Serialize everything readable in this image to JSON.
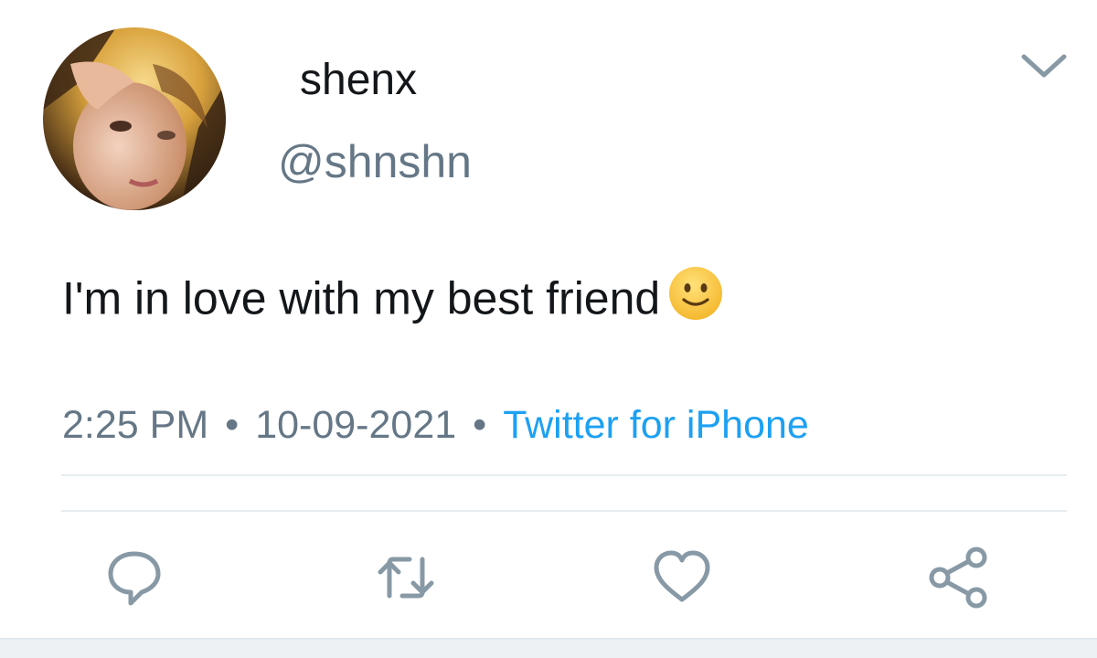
{
  "user": {
    "display_name": "shenx",
    "handle": "@shnshn",
    "avatar_icon": "profile-photo"
  },
  "tweet": {
    "text": "I'm in love with my best friend",
    "emoji": "slightly-smiling-face"
  },
  "meta": {
    "time": "2:25 PM",
    "separator": "•",
    "date": "10-09-2021",
    "source": "Twitter for iPhone"
  },
  "actions": {
    "reply_icon": "reply-icon",
    "retweet_icon": "retweet-icon",
    "like_icon": "heart-icon",
    "share_icon": "share-icon"
  },
  "colors": {
    "text": "#14171a",
    "secondary": "#657786",
    "link": "#1da1f2",
    "divider": "#e6ecf0",
    "icon": "#657786"
  }
}
